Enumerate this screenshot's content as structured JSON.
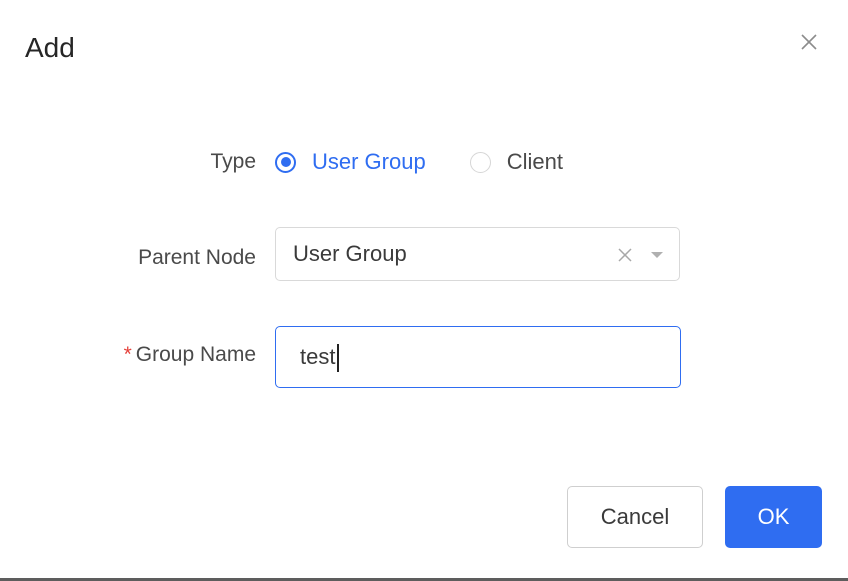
{
  "dialog": {
    "title": "Add"
  },
  "form": {
    "type": {
      "label": "Type",
      "options": [
        {
          "label": "User Group",
          "selected": true
        },
        {
          "label": "Client",
          "selected": false
        }
      ]
    },
    "parent_node": {
      "label": "Parent Node",
      "value": "User Group"
    },
    "group_name": {
      "required_marker": "*",
      "label": "Group Name",
      "value": "test"
    }
  },
  "footer": {
    "cancel_label": "Cancel",
    "ok_label": "OK"
  },
  "colors": {
    "accent": "#2f6df1",
    "required": "#e5403a",
    "text": "#4a4a4a"
  },
  "icons": {
    "close": "close-icon",
    "clear": "clear-icon",
    "dropdown": "chevron-down-icon"
  }
}
